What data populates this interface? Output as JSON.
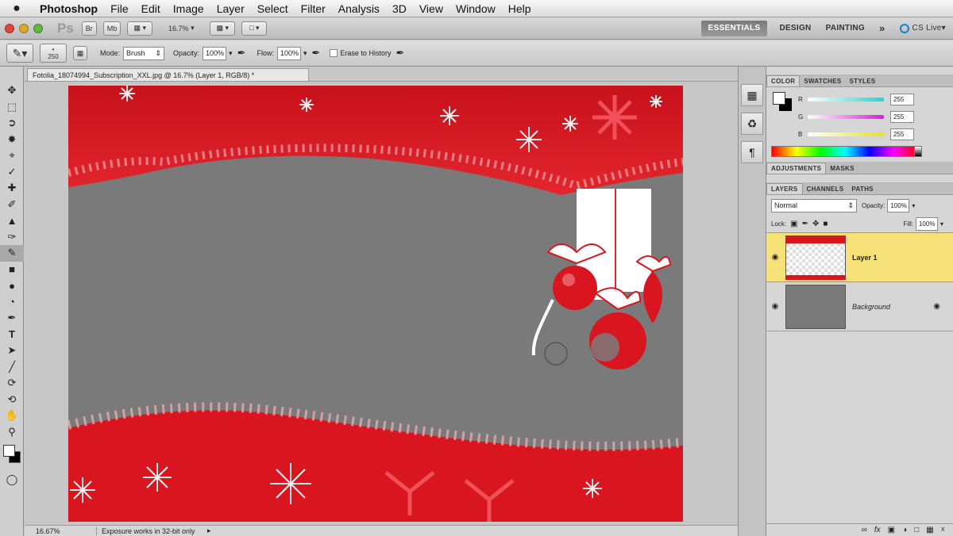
{
  "menu": {
    "apple": "",
    "items": [
      "Photoshop",
      "File",
      "Edit",
      "Image",
      "Layer",
      "Select",
      "Filter",
      "Analysis",
      "3D",
      "View",
      "Window",
      "Help"
    ]
  },
  "appbar": {
    "logo": "Ps",
    "br_label": "Br",
    "mb_label": "Mb",
    "zoom": "16.7%",
    "workspaces": [
      "ESSENTIALS",
      "DESIGN",
      "PAINTING"
    ],
    "more": "»",
    "cs_live": "CS Live"
  },
  "options": {
    "brush_size": "250",
    "mode_label": "Mode:",
    "mode_value": "Brush",
    "opacity_label": "Opacity:",
    "opacity_value": "100%",
    "flow_label": "Flow:",
    "flow_value": "100%",
    "erase_history": "Erase to History"
  },
  "document": {
    "tab_title": "Fotolia_18074994_Subscription_XXL.jpg @ 16.7% (Layer 1, RGB/8) *"
  },
  "status": {
    "zoom": "16.67%",
    "message": "Exposure works in 32-bit only"
  },
  "color_panel": {
    "tabs": [
      "COLOR",
      "SWATCHES",
      "STYLES"
    ],
    "channels": [
      {
        "label": "R",
        "value": "255",
        "color": "#1fd6d6"
      },
      {
        "label": "G",
        "value": "255",
        "color": "#d61fd6"
      },
      {
        "label": "B",
        "value": "255",
        "color": "#e6e21f"
      }
    ]
  },
  "adjustments_tabs": [
    "ADJUSTMENTS",
    "MASKS"
  ],
  "layers_panel": {
    "tabs": [
      "LAYERS",
      "CHANNELS",
      "PATHS"
    ],
    "blend_mode": "Normal",
    "opacity_label": "Opacity:",
    "opacity_value": "100%",
    "lock_label": "Lock:",
    "fill_label": "Fill:",
    "fill_value": "100%",
    "layers": [
      {
        "name": "Layer 1",
        "selected": true
      },
      {
        "name": "Background",
        "selected": false
      }
    ]
  },
  "colors": {
    "accent_red": "#d7161e",
    "layer_selected": "#f7e27a",
    "canvas_gray": "#7a7a7a"
  }
}
